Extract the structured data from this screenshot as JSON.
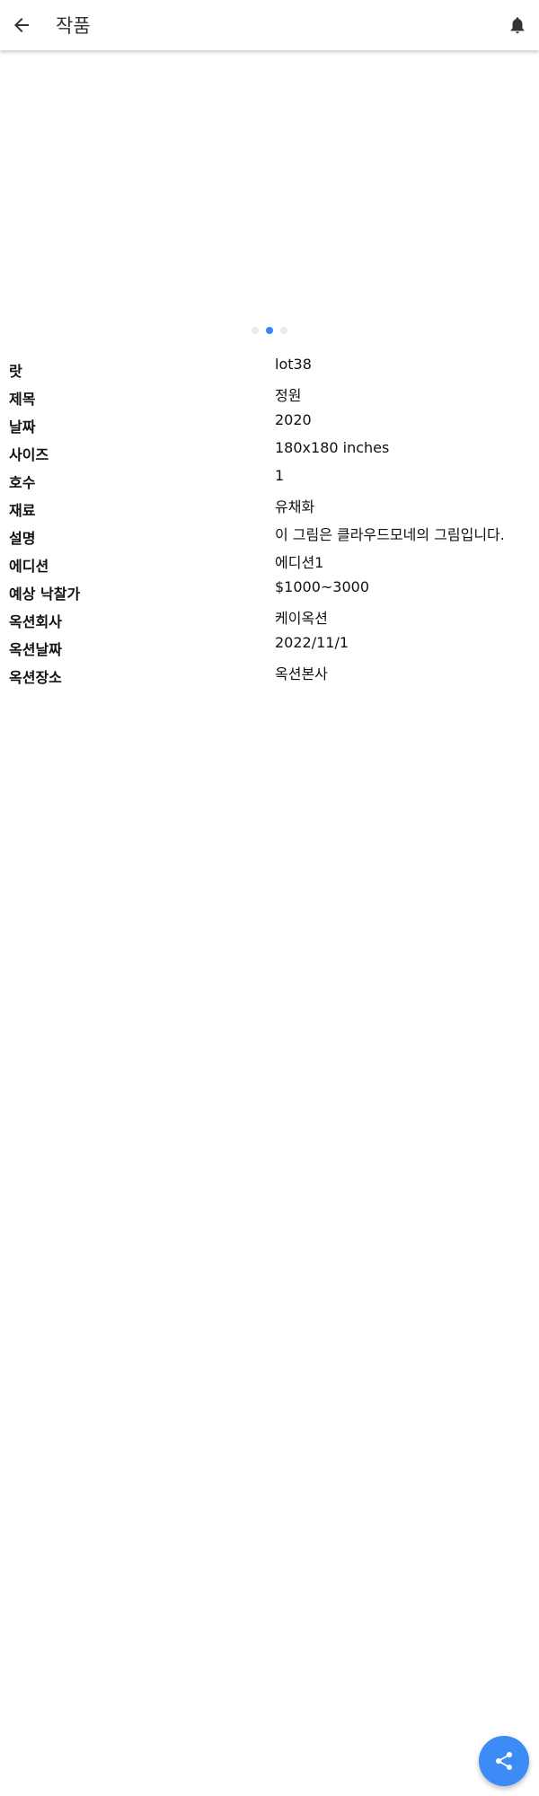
{
  "app_bar": {
    "title": "작품",
    "back_icon": "arrow-left-icon",
    "bell_icon": "bell-icon"
  },
  "carousel": {
    "slide_count": 3,
    "active_index": 1,
    "colors": {
      "active": "#3a86f0",
      "inactive": "#e8edf3"
    }
  },
  "details": [
    {
      "label": "랏",
      "value": "lot38"
    },
    {
      "label": "제목",
      "value": "정원"
    },
    {
      "label": "날짜",
      "value": "2020"
    },
    {
      "label": "사이즈",
      "value": "180x180 inches"
    },
    {
      "label": "호수",
      "value": "1"
    },
    {
      "label": "재료",
      "value": "유채화"
    },
    {
      "label": "설명",
      "value": "이 그림은 클라우드모네의 그림입니다."
    },
    {
      "label": "에디션",
      "value": "에디션1"
    },
    {
      "label": "예상 낙찰가",
      "value": "$1000~3000"
    },
    {
      "label": "옥션회사",
      "value": "케이옥션"
    },
    {
      "label": "옥션날짜",
      "value": "2022/11/1"
    },
    {
      "label": "옥션장소",
      "value": "옥션본사"
    }
  ],
  "fab": {
    "icon": "share-icon",
    "color": "#3d8bf7"
  }
}
